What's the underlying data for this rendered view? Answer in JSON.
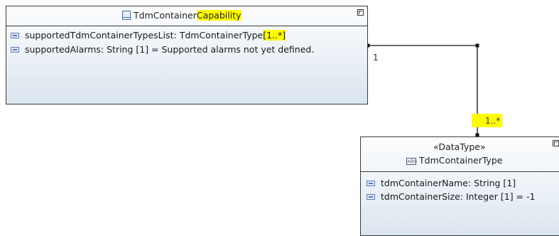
{
  "class_capability": {
    "name_part1": "TdmContainer",
    "name_part2": "Capability",
    "attributes": [
      {
        "text": "supportedTdmContainerTypesList: TdmContainerType ",
        "mult": "[1..*]"
      },
      {
        "text": "supportedAlarms: String [1] = Supported alarms not yet defined.",
        "mult": ""
      }
    ]
  },
  "association": {
    "source_multiplicity": "1",
    "target_multiplicity": "1..*"
  },
  "class_type": {
    "stereotype": "«DataType»",
    "name": "TdmContainerType",
    "attributes": [
      {
        "text": "tdmContainerName: String [1]"
      },
      {
        "text": "tdmContainerSize: Integer [1] = -1"
      }
    ]
  },
  "icons": [
    "class-icon",
    "attribute-icon",
    "datatype-icon",
    "corner-handle-icon"
  ],
  "colors": {
    "highlight": "#fffb00",
    "border": "#3a3a3a",
    "attribute_icon": "#5a7bbd"
  }
}
